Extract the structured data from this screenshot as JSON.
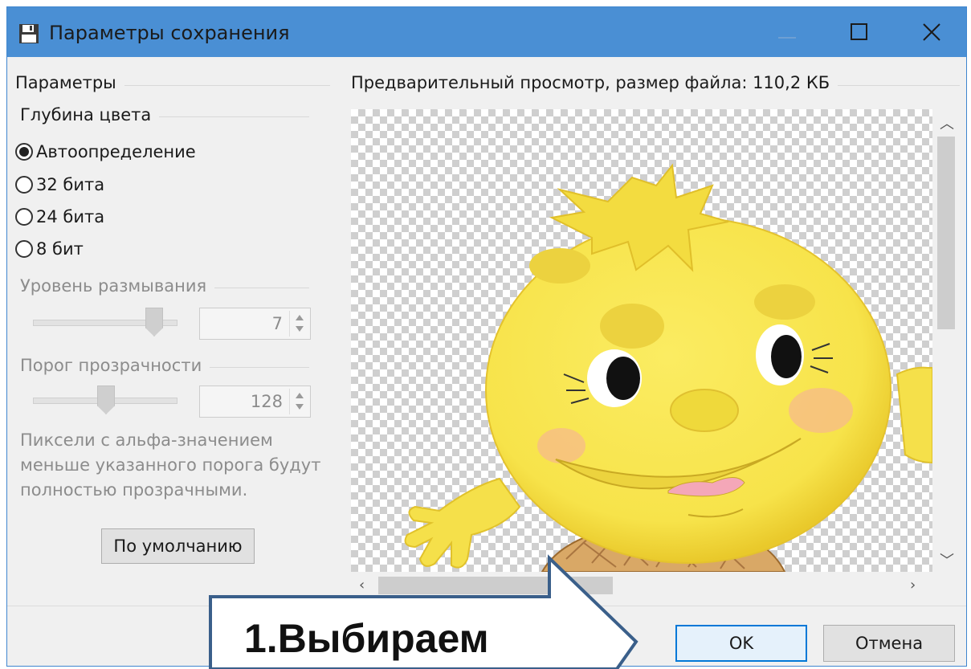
{
  "window": {
    "title": "Параметры сохранения"
  },
  "params": {
    "group_title": "Параметры",
    "color_depth": {
      "title": "Глубина цвета",
      "options": [
        {
          "label": "Автоопределение",
          "checked": true
        },
        {
          "label": "32 бита",
          "checked": false
        },
        {
          "label": "24 бита",
          "checked": false
        },
        {
          "label": "8 бит",
          "checked": false
        }
      ]
    },
    "blur": {
      "title": "Уровень размывания",
      "value": "7",
      "level": 0.7
    },
    "threshold": {
      "title": "Порог прозрачности",
      "value": "128",
      "level": 0.5
    },
    "note": "Пиксели с альфа-значением меньше указанного порога будут полностью прозрачными.",
    "default_button": "По умолчанию"
  },
  "preview": {
    "title": "Предварительный просмотр, размер файла: 110,2 КБ"
  },
  "buttons": {
    "ok": "OK",
    "cancel": "Отмена"
  },
  "callout": {
    "text": "1.Выбираем"
  },
  "colors": {
    "titlebar": "#4a8fd4",
    "accent": "#0078d7",
    "face": "#f7e34a"
  }
}
